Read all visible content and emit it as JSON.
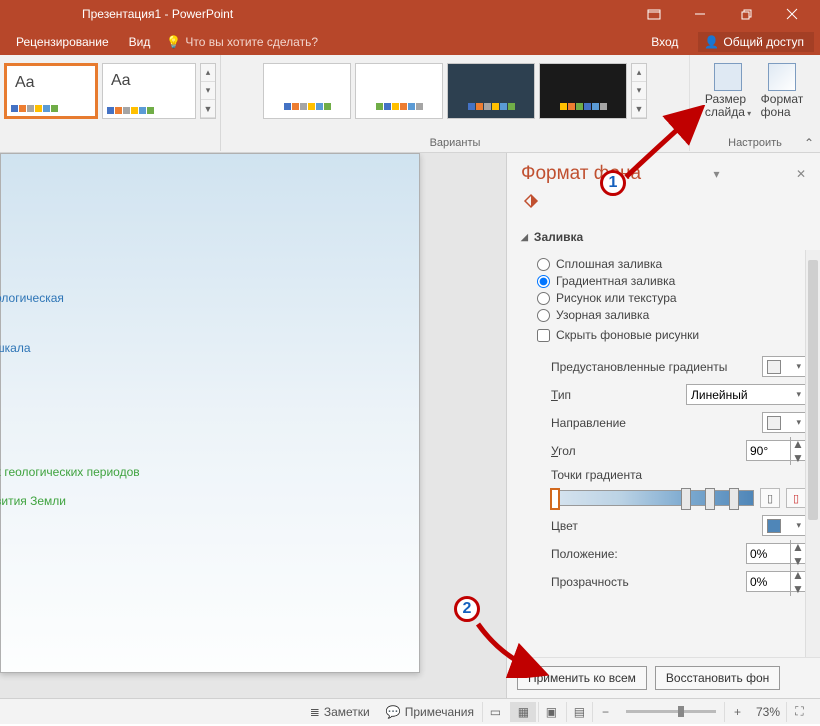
{
  "titlebar": {
    "title": "Презентация1 - PowerPoint"
  },
  "menubar": {
    "tab_review": "Рецензирование",
    "tab_view": "Вид",
    "tell_me": "Что вы хотите сделать?",
    "sign_in": "Вход",
    "share": "Общий доступ"
  },
  "ribbon": {
    "variants_label": "Варианты",
    "configure_label": "Настроить",
    "size_btn": "Размер\nслайда",
    "size_btn_l1": "Размер",
    "size_btn_l2": "слайда",
    "format_btn_l1": "Формат",
    "format_btn_l2": "фона",
    "theme_aa": "Aa"
  },
  "slide": {
    "title_l1": "ологическая",
    "title_l2": "шкала",
    "sub_l1": "х геологических периодов",
    "sub_l2": "вития Земли"
  },
  "panel": {
    "title": "Формат фона",
    "section_fill": "Заливка",
    "radio_solid": "Сплошная заливка",
    "radio_gradient": "Градиентная заливка",
    "radio_picture": "Рисунок или текстура",
    "radio_pattern": "Узорная заливка",
    "check_hide": "Скрыть фоновые рисунки",
    "preset": "Предустановленные градиенты",
    "type": "Тип",
    "type_val": "Линейный",
    "direction": "Направление",
    "angle": "Угол",
    "angle_val": "90°",
    "stops": "Точки градиента",
    "color": "Цвет",
    "position": "Положение:",
    "position_val": "0%",
    "transparency": "Прозрачность",
    "transparency_val": "0%",
    "apply_all": "Применить ко всем",
    "reset": "Восстановить фон"
  },
  "status": {
    "notes": "Заметки",
    "comments": "Примечания",
    "zoom": "73%"
  },
  "anno": {
    "n1": "1",
    "n2": "2"
  }
}
